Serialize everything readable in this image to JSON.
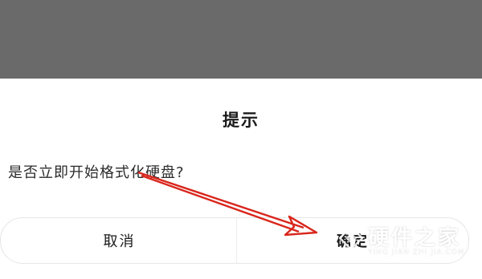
{
  "dialog": {
    "title": "提示",
    "message": "是否立即开始格式化硬盘?",
    "cancel_label": "取消",
    "confirm_label": "确定"
  },
  "watermark": {
    "text": "硬件之家",
    "subtext": "YING JIAN ZHI JIA.COM"
  },
  "colors": {
    "backdrop": "#6a6a6a",
    "arrow": "#d9261c",
    "dialog_bg": "#ffffff"
  },
  "icons": {
    "annotation": "red-arrow",
    "watermark_logo": "diamond-logo-icon"
  }
}
